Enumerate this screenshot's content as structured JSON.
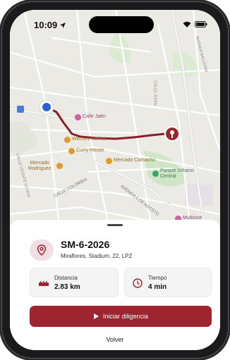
{
  "status_bar": {
    "time": "10:09"
  },
  "map": {
    "labels": {
      "calle_jaen": "Calle Jaén",
      "witches_market": "Witches Market",
      "curry_house": "Curry House",
      "mercado_rodriguez": "Mercado\nRodríguez",
      "mercado_camacho": "Mercado Camacho",
      "parque_urbano": "Parque Urbano\nCentral",
      "multicine": "Multicine",
      "calle_colombia": "CALLE COLOMBIA",
      "av_6_agosto": "AVENIDA 6 DE AGOSTO",
      "calle_junin": "CALLE JUNIN",
      "calle_vicente_ochoa": "CALLE VICENTE OCHOA",
      "av_ballivian": "AVENIDA BALLIVIAN"
    }
  },
  "destination": {
    "code": "SM-6-2026",
    "address": "Miraflores, Stadium, 22, LPZ"
  },
  "stats": {
    "distance_label": "Distancia",
    "distance_value": "2.83 km",
    "time_label": "Tiempo",
    "time_value": "4 min"
  },
  "actions": {
    "start_label": "Iniciar diligencia",
    "back_label": "Volver"
  },
  "colors": {
    "accent": "#9e2430",
    "route": "#8c1d2a",
    "origin_marker": "#2f5fd0"
  }
}
